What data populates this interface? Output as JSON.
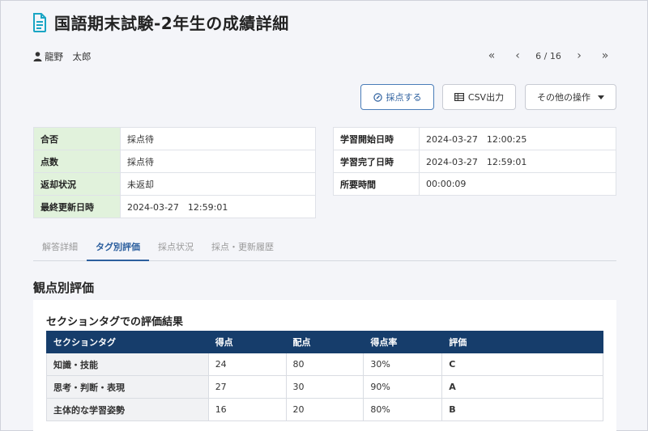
{
  "header": {
    "title": "国語期末試験-2年生の成績詳細",
    "user_name": "龍野　太郎"
  },
  "pager": {
    "first_icon": "«",
    "prev_icon": "‹",
    "count": "6 / 16",
    "next_icon": "›",
    "last_icon": "»"
  },
  "actions": {
    "score_label": "採点する",
    "csv_label": "CSV出力",
    "more_label": "その他の操作"
  },
  "info_left": [
    {
      "label": "合否",
      "value": "採点待"
    },
    {
      "label": "点数",
      "value": "採点待"
    },
    {
      "label": "返却状況",
      "value": "未返却"
    },
    {
      "label": "最終更新日時",
      "value": "2024-03-27　12:59:01"
    }
  ],
  "info_right": [
    {
      "label": "学習開始日時",
      "value": "2024-03-27　12:00:25"
    },
    {
      "label": "学習完了日時",
      "value": "2024-03-27　12:59:01"
    },
    {
      "label": "所要時間",
      "value": "00:00:09"
    }
  ],
  "tabs": [
    {
      "label": "解答詳細",
      "active": false
    },
    {
      "label": "タグ別評価",
      "active": true
    },
    {
      "label": "採点状況",
      "active": false
    },
    {
      "label": "採点・更新履歴",
      "active": false
    }
  ],
  "section": {
    "title": "観点別評価",
    "card_title": "セクションタグでの評価結果"
  },
  "eval_table": {
    "headers": [
      "セクションタグ",
      "得点",
      "配点",
      "得点率",
      "評価"
    ],
    "rows": [
      [
        "知識・技能",
        "24",
        "80",
        "30%",
        "C"
      ],
      [
        "思考・判断・表現",
        "27",
        "30",
        "90%",
        "A"
      ],
      [
        "主体的な学習姿勢",
        "16",
        "20",
        "80%",
        "B"
      ]
    ]
  },
  "colors": {
    "accent": "#2c5f9e",
    "table_header": "#163d6b",
    "label_green": "#e1f2dc",
    "icon_teal": "#1aa5c4"
  }
}
